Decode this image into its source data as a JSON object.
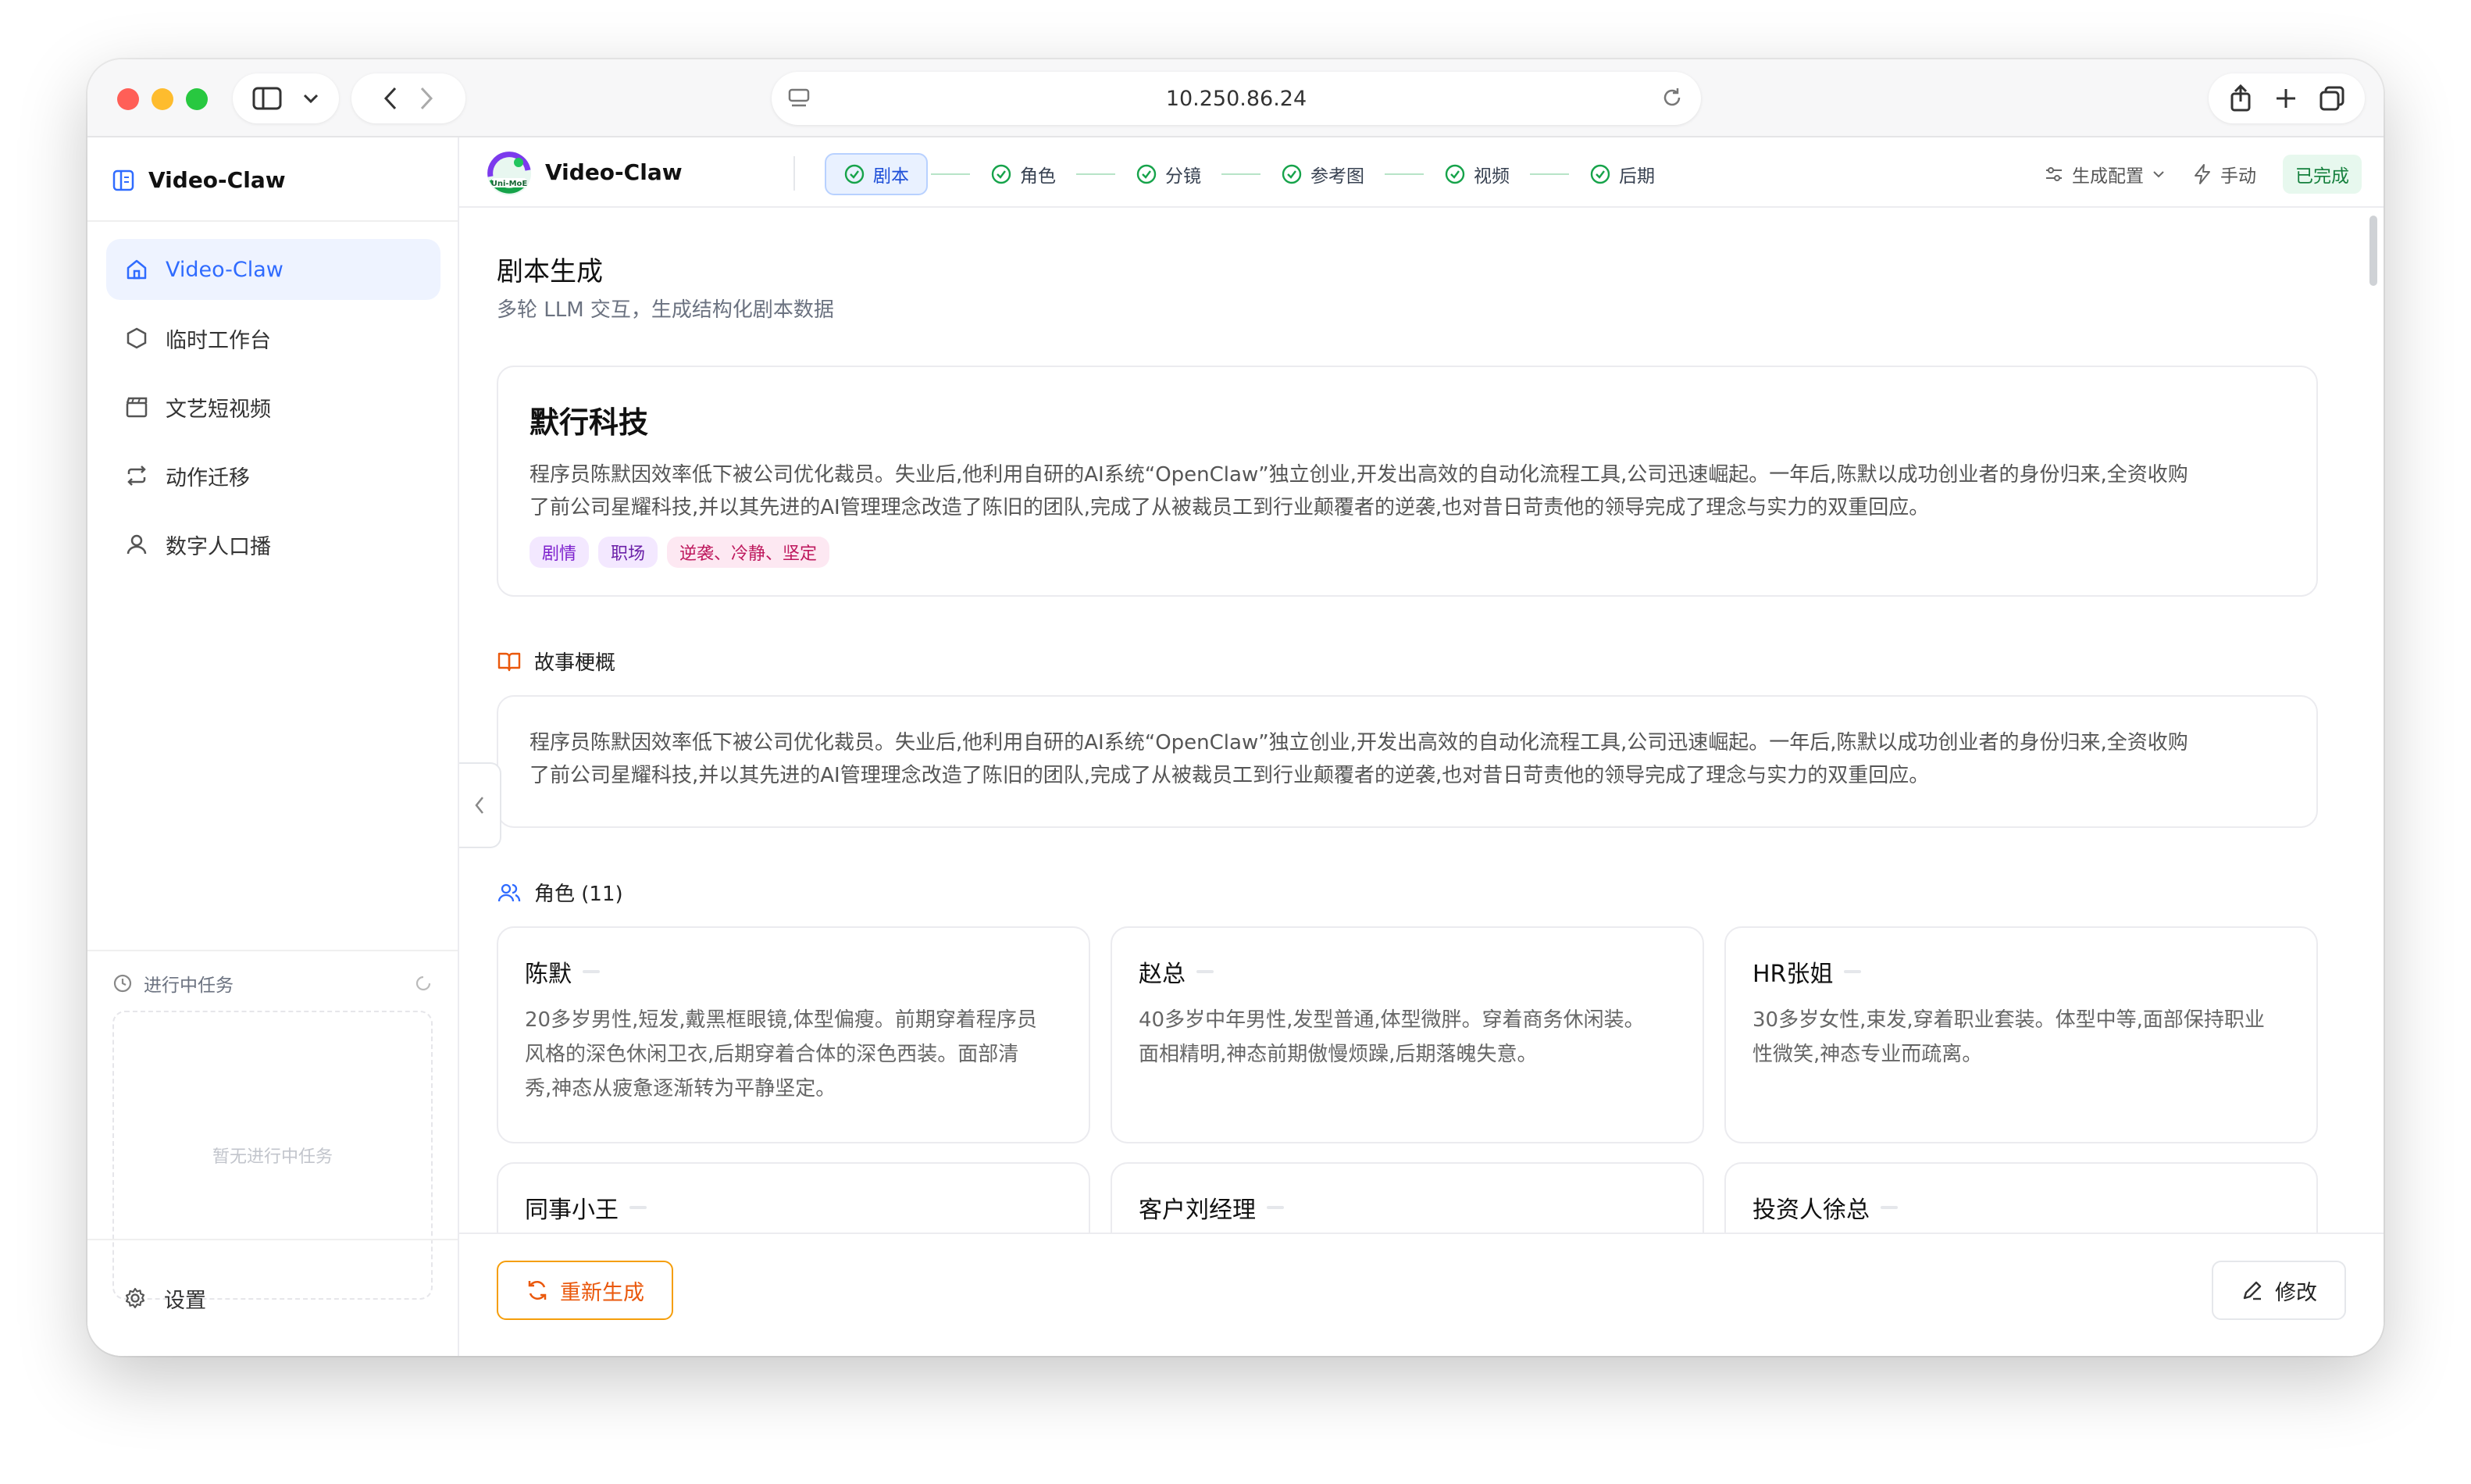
{
  "browser": {
    "address": "10.250.86.24"
  },
  "sidebar": {
    "brand": "Video-Claw",
    "items": [
      {
        "label": "Video-Claw",
        "icon": "home-icon",
        "active": true
      },
      {
        "label": "临时工作台",
        "icon": "hexagon-icon",
        "active": false
      },
      {
        "label": "文艺短视频",
        "icon": "clapperboard-icon",
        "active": false
      },
      {
        "label": "动作迁移",
        "icon": "repeat-icon",
        "active": false
      },
      {
        "label": "数字人口播",
        "icon": "user-icon",
        "active": false
      }
    ],
    "tasks_title": "进行中任务",
    "tasks_empty": "暂无进行中任务",
    "settings_label": "设置"
  },
  "topnav": {
    "app_name": "Video-Claw",
    "steps": [
      "剧本",
      "角色",
      "分镜",
      "参考图",
      "视频",
      "后期"
    ],
    "config_label": "生成配置",
    "mode_label": "手动",
    "status_label": "已完成"
  },
  "page": {
    "title": "剧本生成",
    "subtitle": "多轮 LLM 交互，生成结构化剧本数据"
  },
  "script": {
    "title": "默行科技",
    "description_line1": "程序员陈默因效率低下被公司优化裁员。失业后,他利用自研的AI系统“OpenClaw”独立创业,开发出高效的自动化流程工具,公司迅速崛起。一年后,陈默以成功创业者的身份归来,全资收购",
    "description_line2": "了前公司星耀科技,并以其先进的AI管理理念改造了陈旧的团队,完成了从被裁员工到行业颠覆者的逆袭,也对昔日苛责他的领导完成了理念与实力的双重回应。",
    "tags": [
      "剧情",
      "职场",
      "逆袭、冷静、坚定"
    ]
  },
  "story": {
    "heading": "故事梗概",
    "line1": "程序员陈默因效率低下被公司优化裁员。失业后,他利用自研的AI系统“OpenClaw”独立创业,开发出高效的自动化流程工具,公司迅速崛起。一年后,陈默以成功创业者的身份归来,全资收购",
    "line2": "了前公司星耀科技,并以其先进的AI管理理念改造了陈旧的团队,完成了从被裁员工到行业颠覆者的逆袭,也对昔日苛责他的领导完成了理念与实力的双重回应。"
  },
  "roles": {
    "heading": "角色 (11)",
    "items": [
      {
        "name": "陈默",
        "desc": [
          "20多岁男性,短发,戴黑框眼镜,体型偏瘦。前期穿着程序员",
          "风格的深色休闲卫衣,后期穿着合体的深色西装。面部清",
          "秀,神态从疲惫逐渐转为平静坚定。"
        ]
      },
      {
        "name": "赵总",
        "desc": [
          "40多岁中年男性,发型普通,体型微胖。穿着商务休闲装。",
          "面相精明,神态前期傲慢烦躁,后期落魄失意。",
          ""
        ]
      },
      {
        "name": "HR张姐",
        "desc": [
          "30多岁女性,束发,穿着职业套装。体型中等,面部保持职业",
          "性微笑,神态专业而疏离。",
          ""
        ]
      },
      {
        "name": "同事小王",
        "desc": [
          "",
          "",
          ""
        ]
      },
      {
        "name": "客户刘经理",
        "desc": [
          "",
          "",
          ""
        ]
      },
      {
        "name": "投资人徐总",
        "desc": [
          "",
          "",
          ""
        ]
      }
    ]
  },
  "actions": {
    "regenerate_label": "重新生成",
    "edit_label": "修改"
  },
  "colors": {
    "accent": "#2f6bff",
    "success": "#16a34a",
    "warning": "#ea580c"
  }
}
